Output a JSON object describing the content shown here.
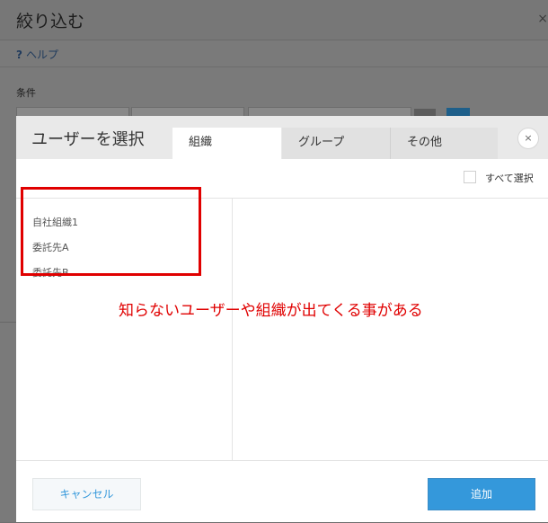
{
  "background_dialog": {
    "title": "絞り込む",
    "close_glyph": "×",
    "help_label": "ヘルプ",
    "help_icon": "?",
    "condition_label": "条件"
  },
  "modal": {
    "title": "ユーザーを選択",
    "tabs": [
      {
        "label": "組織",
        "active": true
      },
      {
        "label": "グループ",
        "active": false
      },
      {
        "label": "その他",
        "active": false
      }
    ],
    "close_glyph": "×",
    "select_all_label": "すべて選択",
    "organizations": [
      "自社組織1",
      "委託先A",
      "委託先B"
    ],
    "annotation": "知らないユーザーや組織が出てくる事がある",
    "cancel_label": "キャンセル",
    "add_label": "追加"
  },
  "colors": {
    "accent": "#3498db",
    "annotation": "#e00000"
  }
}
